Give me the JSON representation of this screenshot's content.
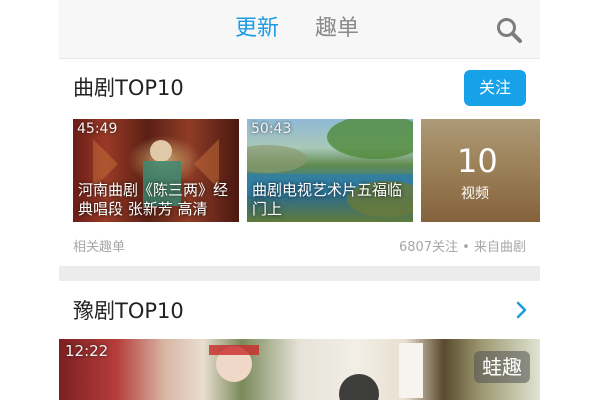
{
  "header": {
    "tabs": [
      {
        "label": "更新",
        "active": true
      },
      {
        "label": "趣单",
        "active": false
      }
    ],
    "search_icon": "search-icon",
    "accent_color": "#1a9be6"
  },
  "sections": [
    {
      "title": "曲剧TOP10",
      "follow_label": "关注",
      "videos": [
        {
          "duration": "45:49",
          "caption": "河南曲剧《陈三两》经典唱段 张新芳 高清"
        },
        {
          "duration": "50:43",
          "caption": "曲剧电视艺术片五福临门上"
        }
      ],
      "more": {
        "count": "10",
        "label": "视频"
      },
      "meta_left": "相关趣单",
      "meta_right": "6807关注 • 来自曲剧"
    },
    {
      "title": "豫剧TOP10",
      "chevron_icon": "chevron-right-icon",
      "videos": [
        {
          "duration": "12:22",
          "badge": "蛙趣"
        }
      ]
    }
  ]
}
